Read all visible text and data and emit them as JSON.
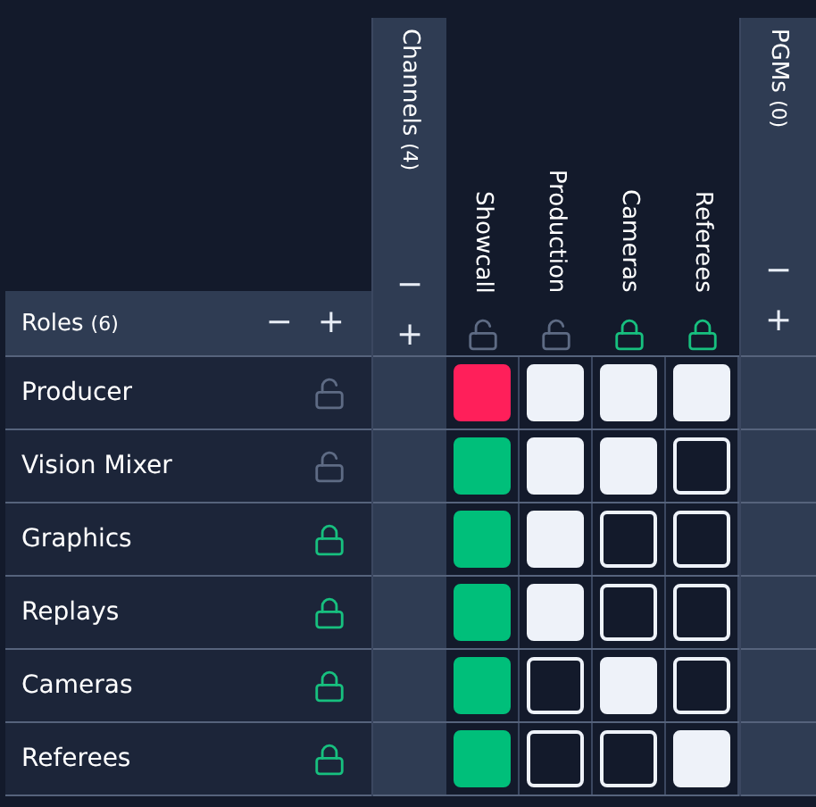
{
  "channels": {
    "title": "Channels",
    "count": "(4)",
    "buttons": [
      "−",
      "+"
    ],
    "items": [
      {
        "name": "Showcall",
        "locked": false
      },
      {
        "name": "Production",
        "locked": false
      },
      {
        "name": "Cameras",
        "locked": true
      },
      {
        "name": "Referees",
        "locked": true
      }
    ]
  },
  "pgms": {
    "title": "PGMs",
    "count": "(0)",
    "buttons": [
      "−",
      "+"
    ]
  },
  "roles": {
    "title": "Roles",
    "count": "(6)",
    "buttons": [
      "−",
      "+"
    ],
    "items": [
      {
        "name": "Producer",
        "locked": false
      },
      {
        "name": "Vision Mixer",
        "locked": false
      },
      {
        "name": "Graphics",
        "locked": true
      },
      {
        "name": "Replays",
        "locked": true
      },
      {
        "name": "Cameras",
        "locked": true
      },
      {
        "name": "Referees",
        "locked": true
      }
    ]
  },
  "matrix": [
    [
      {
        "kind": "status",
        "alert": true
      },
      {
        "kind": "toggle",
        "checked": true
      },
      {
        "kind": "toggle",
        "checked": true
      },
      {
        "kind": "toggle",
        "checked": true
      }
    ],
    [
      {
        "kind": "status",
        "alert": false
      },
      {
        "kind": "toggle",
        "checked": true
      },
      {
        "kind": "toggle",
        "checked": true
      },
      {
        "kind": "toggle",
        "checked": false
      }
    ],
    [
      {
        "kind": "status",
        "alert": false
      },
      {
        "kind": "toggle",
        "checked": true
      },
      {
        "kind": "toggle",
        "checked": false
      },
      {
        "kind": "toggle",
        "checked": false
      }
    ],
    [
      {
        "kind": "status",
        "alert": false
      },
      {
        "kind": "toggle",
        "checked": true
      },
      {
        "kind": "toggle",
        "checked": false
      },
      {
        "kind": "toggle",
        "checked": false
      }
    ],
    [
      {
        "kind": "status",
        "alert": false
      },
      {
        "kind": "toggle",
        "checked": false
      },
      {
        "kind": "toggle",
        "checked": true
      },
      {
        "kind": "toggle",
        "checked": false
      }
    ],
    [
      {
        "kind": "status",
        "alert": false
      },
      {
        "kind": "toggle",
        "checked": false
      },
      {
        "kind": "toggle",
        "checked": false
      },
      {
        "kind": "toggle",
        "checked": true
      }
    ]
  ]
}
